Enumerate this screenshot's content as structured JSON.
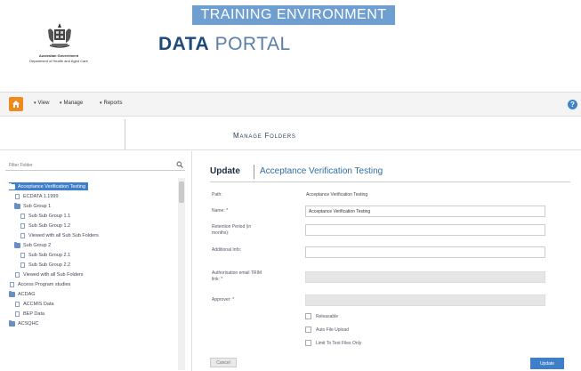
{
  "header": {
    "training_banner": "TRAINING ENVIRONMENT",
    "gov_line1": "Australian Government",
    "gov_line2": "Department of Health and Aged Care",
    "portal_bold": "DATA",
    "portal_light": "PORTAL"
  },
  "nav": {
    "items": [
      {
        "label": "View"
      },
      {
        "label": "Manage"
      },
      {
        "label": "Reports"
      }
    ],
    "help_label": "?"
  },
  "page": {
    "title": "Manage Folders"
  },
  "sidebar": {
    "search_placeholder": "Filter Folder",
    "tree": [
      {
        "label": "Acceptance Verification Testing",
        "type": "folder",
        "selected": true
      },
      {
        "label": "ECDATA 1.1999",
        "type": "file"
      },
      {
        "label": "Sub Group 1",
        "type": "folder"
      },
      {
        "label": "Sub Sub Group 1.1",
        "type": "file"
      },
      {
        "label": "Sub Sub Group 1.2",
        "type": "file"
      },
      {
        "label": "Viewed with all Sub Sub Folders",
        "type": "file"
      },
      {
        "label": "Sub Group 2",
        "type": "folder"
      },
      {
        "label": "Sub Sub Group 2.1",
        "type": "file"
      },
      {
        "label": "Sub Sub Group 2.2",
        "type": "file"
      },
      {
        "label": "Viewed with all Sub Folders",
        "type": "file"
      },
      {
        "label": "Access Program studies",
        "type": "file"
      },
      {
        "label": "ACDAG",
        "type": "folder"
      },
      {
        "label": "ACCMIS Data",
        "type": "file"
      },
      {
        "label": "BEP Data",
        "type": "file"
      },
      {
        "label": "ACSQHC",
        "type": "folder"
      }
    ]
  },
  "form": {
    "heading": "Update",
    "folder_name": "Acceptance Verification Testing",
    "path_label": "Path:",
    "path_value": "Acceptance Verification Testing",
    "name_label": "Name: *",
    "name_value": "Acceptance Verification Testing",
    "retention_label": "Retention Period (in months):",
    "retention_value": "",
    "additional_label": "Additional Info:",
    "additional_value": "",
    "auth_label": "Authorisation email TRIM link: *",
    "auth_value": "",
    "approver_label": "Approver: *",
    "approver_value": "",
    "checkboxes": [
      {
        "label": "Releasable"
      },
      {
        "label": "Auto File Upload"
      },
      {
        "label": "Limit To Text Files Only"
      }
    ],
    "cancel_label": "Cancel",
    "update_label": "Update"
  }
}
